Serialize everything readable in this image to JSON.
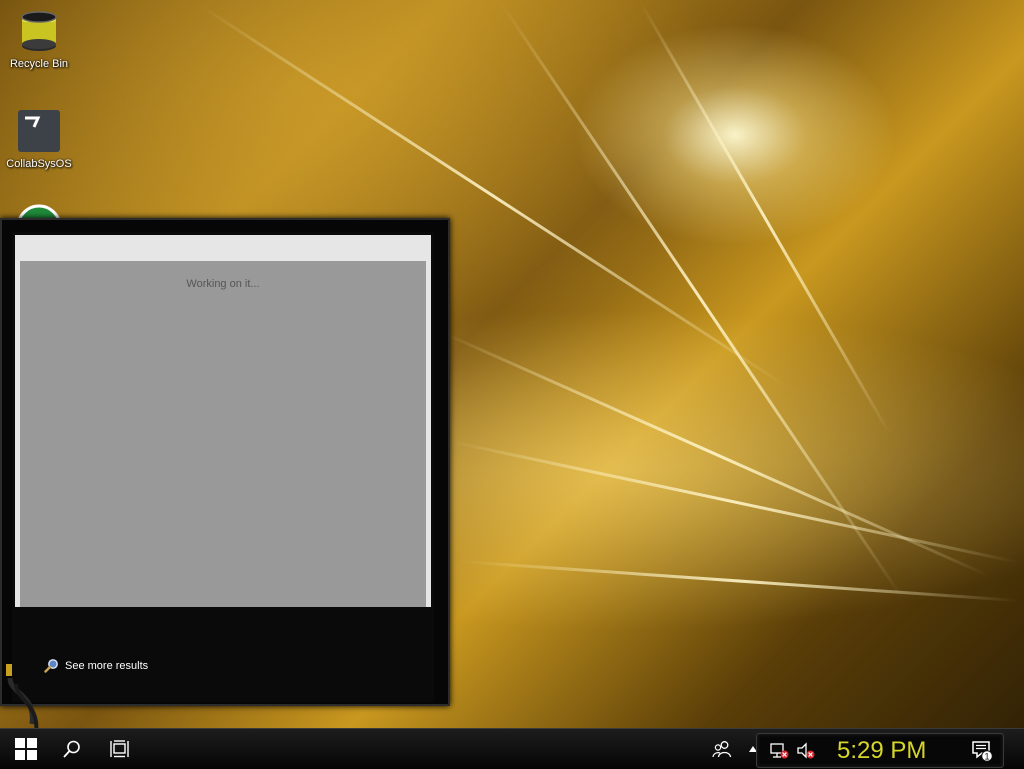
{
  "desktop": {
    "icons": [
      {
        "label": "Recycle Bin",
        "icon": "recycle-bin-icon"
      },
      {
        "label": "CollabSysOS",
        "icon": "collabsysos-icon"
      },
      {
        "label": "",
        "icon": "partially-hidden-app-icon"
      }
    ]
  },
  "search_popup": {
    "status_text": "Working on it...",
    "see_more_label": "See more results"
  },
  "taskbar": {
    "start_icon": "windows-logo-icon",
    "search_icon": "search-icon",
    "task_view_icon": "task-view-icon",
    "people_icon": "people-icon",
    "tray_expand_icon": "chevron-up-icon",
    "network_icon": "network-disconnected-icon",
    "volume_icon": "volume-muted-icon",
    "clock": "5:29 PM",
    "notification_count": "1"
  },
  "colors": {
    "clock_text": "#d6d62a",
    "popup_body": "#999999",
    "taskbar": "#0a0a0a"
  }
}
